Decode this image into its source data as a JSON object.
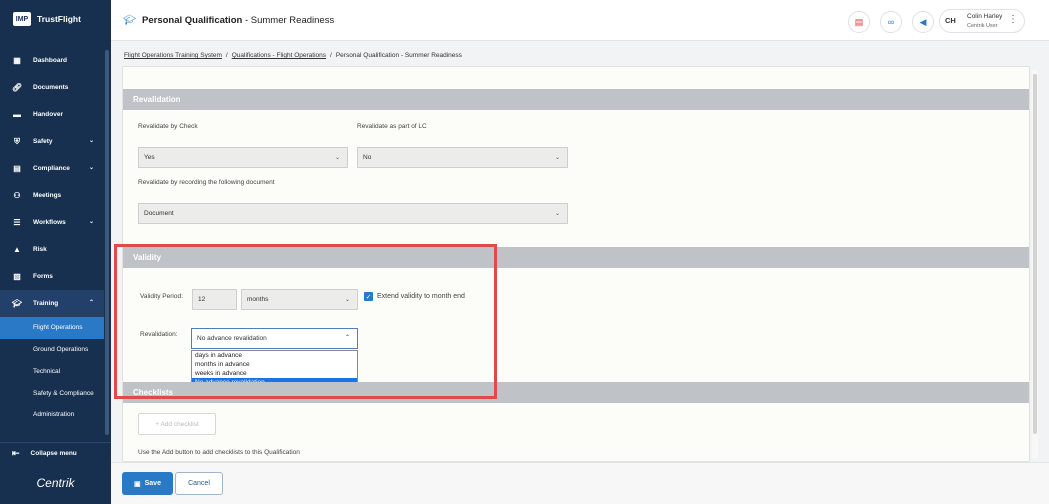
{
  "brand": {
    "logo": "IMP",
    "name": "TrustFlight"
  },
  "sidebar": {
    "items": [
      {
        "label": "Dashboard",
        "icon": "dashboard-icon"
      },
      {
        "label": "Documents",
        "icon": "paperclip-icon"
      },
      {
        "label": "Handover",
        "icon": "handover-icon"
      },
      {
        "label": "Safety",
        "icon": "shield-icon"
      },
      {
        "label": "Compliance",
        "icon": "compliance-icon"
      },
      {
        "label": "Meetings",
        "icon": "meetings-icon"
      },
      {
        "label": "Workflows",
        "icon": "workflows-icon"
      },
      {
        "label": "Risk",
        "icon": "warning-icon"
      },
      {
        "label": "Forms",
        "icon": "forms-icon"
      },
      {
        "label": "Training",
        "icon": "graduation-cap-icon"
      }
    ],
    "training_sub": [
      "Flight Operations",
      "Ground Operations",
      "Technical",
      "Safety & Compliance",
      "Administration"
    ],
    "collapse_label": "Collapse menu",
    "footer_logo": "Centrik"
  },
  "header": {
    "title_main": "Personal Qualification",
    "title_sep": " - ",
    "title_sub": "Summer Readiness",
    "user": {
      "initials": "CH",
      "name": "Colin Harley",
      "role": "Centrik User"
    }
  },
  "breadcrumb": {
    "items": [
      "Flight Operations Training System",
      "Qualifications - Flight Operations"
    ],
    "current": "Personal Qualification - Summer Readiness",
    "sep": "/"
  },
  "revalidation": {
    "title": "Revalidation",
    "by_check_label": "Revalidate by Check",
    "by_check_value": "Yes",
    "lc_label": "Revalidate as part of LC",
    "lc_value": "No",
    "doc_label": "Revalidate by recording the following document",
    "doc_value": "Document"
  },
  "validity": {
    "title": "Validity",
    "period_label": "Validity Period:",
    "period_value": "12",
    "unit_value": "months",
    "extend_label": "Extend validity to month end",
    "reval_label": "Revalidation:",
    "reval_value": "No advance revalidation",
    "options": [
      "days in advance",
      "months in advance",
      "weeks in advance",
      "No advance revalidation"
    ]
  },
  "checklists": {
    "title": "Checklists",
    "add_label": "+ Add checklist",
    "hint": "Use the Add button to add checklists to this Qualification"
  },
  "footer": {
    "save_label": "Save",
    "cancel_label": "Cancel"
  }
}
